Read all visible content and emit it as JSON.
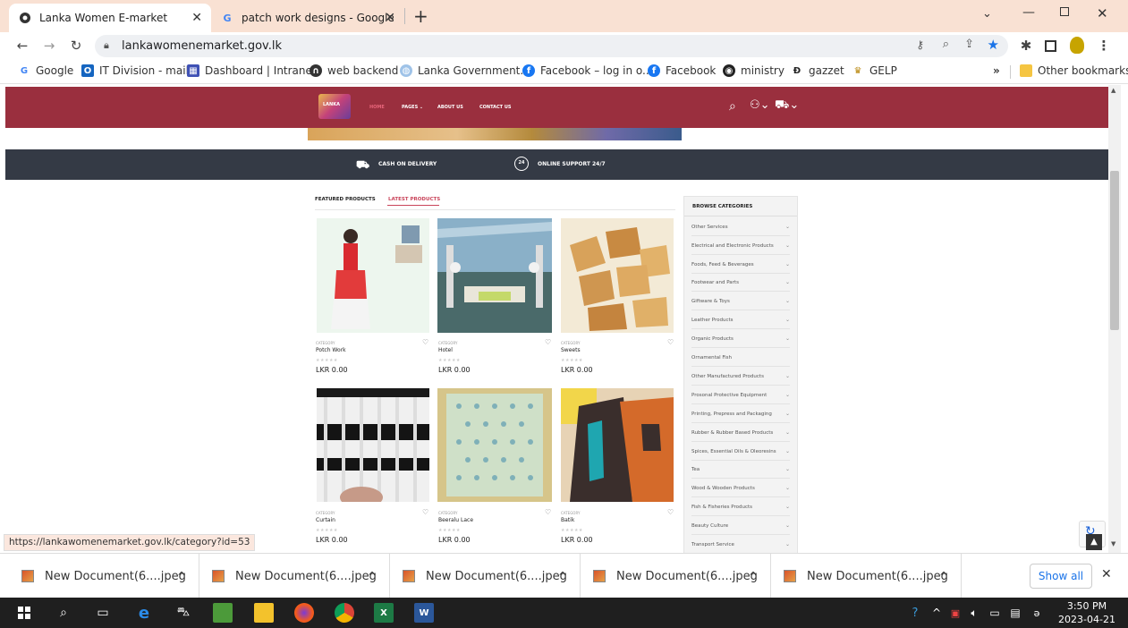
{
  "browser": {
    "tabs": [
      {
        "title": "Lanka Women E-market",
        "active": true
      },
      {
        "title": "patch work designs - Google Sea",
        "active": false
      }
    ],
    "new_tab": "+",
    "window_controls": [
      "chevron-down",
      "minimize",
      "restore",
      "close"
    ],
    "address": "lankawomenemarket.gov.lk",
    "bookmarks": [
      {
        "label": "Google"
      },
      {
        "label": "IT Division - mail"
      },
      {
        "label": "Dashboard | Intranet"
      },
      {
        "label": "web backend"
      },
      {
        "label": "Lanka Government..."
      },
      {
        "label": "Facebook – log in o..."
      },
      {
        "label": "Facebook"
      },
      {
        "label": "ministry"
      },
      {
        "label": "gazzet"
      },
      {
        "label": "GELP"
      }
    ],
    "overflow": "»",
    "other_bookmarks": "Other bookmarks"
  },
  "site": {
    "logo_text": "LANKA",
    "nav": [
      {
        "label": "HOME"
      },
      {
        "label": "PAGES ⌄"
      },
      {
        "label": "ABOUT US"
      },
      {
        "label": "CONTACT US"
      }
    ],
    "infobar": [
      {
        "label": "CASH ON DELIVERY"
      },
      {
        "label": "ONLINE SUPPORT 24/7"
      }
    ],
    "support_badge": "24",
    "tabs": [
      {
        "label": "FEATURED PRODUCTS"
      },
      {
        "label": "LATEST PRODUCTS"
      }
    ],
    "products": [
      {
        "category": "CATEGORY",
        "name": "Potch Work",
        "stars": "★★★★★",
        "price": "LKR 0.00"
      },
      {
        "category": "CATEGORY",
        "name": "Hotel",
        "stars": "★★★★★",
        "price": "LKR 0.00"
      },
      {
        "category": "CATEGORY",
        "name": "Sweets",
        "stars": "★★★★★",
        "price": "LKR 0.00"
      },
      {
        "category": "CATEGORY",
        "name": "Curtain",
        "stars": "★★★★★",
        "price": "LKR 0.00"
      },
      {
        "category": "CATEGORY",
        "name": "Beeralu Lace",
        "stars": "★★★★★",
        "price": "LKR 0.00"
      },
      {
        "category": "CATEGORY",
        "name": "Batik",
        "stars": "★★★★★",
        "price": "LKR 0.00"
      }
    ],
    "categories_title": "BROWSE CATEGORIES",
    "categories": [
      "Other Services",
      "Electrical and Electronic Products",
      "Foods, Feed & Beverages",
      "Footwear and Parts",
      "Giftware & Toys",
      "Leather Products",
      "Organic Products",
      "Ornamental Fish",
      "Other Manufactured Products",
      "Prosonal Protective Equipment",
      "Printing, Prepress and Packaging",
      "Rubber & Rubber Based Products",
      "Spices, Essential Oils & Oleoresins",
      "Tea",
      "Wood & Wooden Products",
      "Fish & Fisheries Products",
      "Beauty Culture",
      "Transport Service"
    ]
  },
  "status_url": "https://lankawomenemarket.gov.lk/category?id=53",
  "downloads": {
    "items": [
      "New Document(6....jpeg",
      "New Document(6....jpeg",
      "New Document(6....jpeg",
      "New Document(6....jpeg",
      "New Document(6....jpeg"
    ],
    "show_all": "Show all",
    "close": "✕"
  },
  "taskbar": {
    "time": "3:50 PM",
    "date": "2023-04-21"
  }
}
